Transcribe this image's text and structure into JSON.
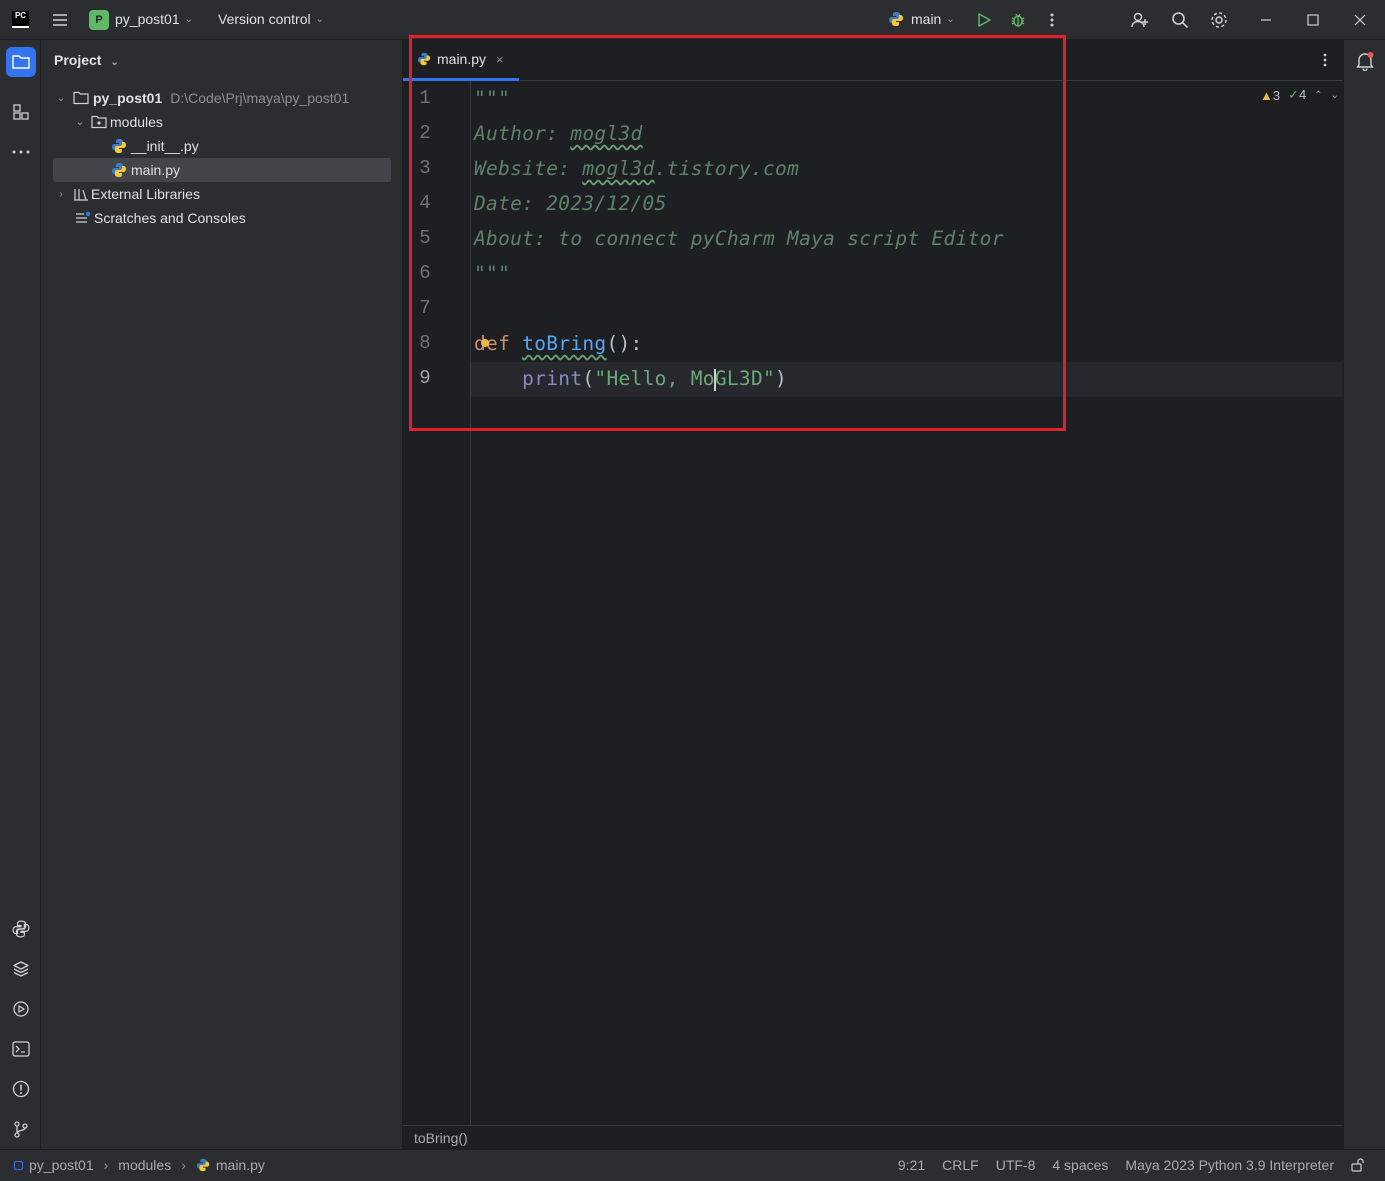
{
  "titlebar": {
    "logo": "PC",
    "project_badge": "P",
    "project_name": "py_post01",
    "vcs_label": "Version control",
    "run_config": "main"
  },
  "toolwindow": {
    "title": "Project"
  },
  "tree": [
    {
      "label": "py_post01",
      "path": "D:\\Code\\Prj\\maya\\py_post01",
      "icon": "folder-icon"
    },
    {
      "label": "modules",
      "icon": "package-icon"
    },
    {
      "label": "__init__.py",
      "icon": "python-file-icon"
    },
    {
      "label": "main.py",
      "icon": "python-file-icon",
      "selected": true
    },
    {
      "label": "External Libraries",
      "icon": "library-icon"
    },
    {
      "label": "Scratches and Consoles",
      "icon": "scratches-icon"
    }
  ],
  "editor": {
    "tab_label": "main.py",
    "line_numbers": [
      "1",
      "2",
      "3",
      "4",
      "5",
      "6",
      "7",
      "8",
      "9"
    ],
    "lines": {
      "l1": "\"\"\"",
      "l2a": "Author: ",
      "l2b": "mogl3d",
      "l3a": "Website: ",
      "l3b": "mogl3d",
      "l3c": ".tistory.com",
      "l4": "Date: 2023/12/05",
      "l5": "About: to connect pyCharm Maya script Editor",
      "l6": "\"\"\"",
      "l8_kw": "def",
      "l8_fn": "toBring",
      "l8_rest": "():",
      "l9_indent": "    ",
      "l9_bi": "print",
      "l9_open": "(",
      "l9_str_a": "\"Hello, Mo",
      "l9_str_b": "GL3D\"",
      "l9_close": ")"
    },
    "inspections": {
      "warnings": "3",
      "weak_warnings": "4"
    },
    "context_crumb": "toBring()"
  },
  "statusbar": {
    "crumbs": [
      "py_post01",
      "modules",
      "main.py"
    ],
    "position": "9:21",
    "line_sep": "CRLF",
    "encoding": "UTF-8",
    "indent": "4 spaces",
    "interpreter": "Maya 2023 Python 3.9 Interpreter"
  },
  "colors": {
    "accent": "#3574f0",
    "highlight_box": "#e0202a",
    "docstring": "#5f826b",
    "keyword": "#cf8e6d",
    "function": "#56a8f5",
    "string": "#6aab73"
  }
}
